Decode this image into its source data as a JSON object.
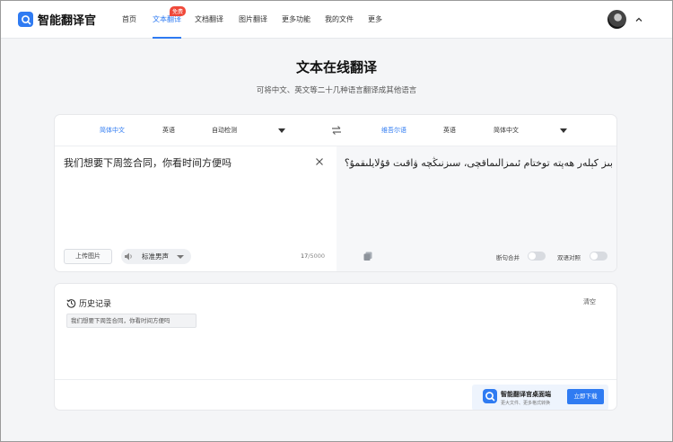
{
  "app": {
    "name": "智能翻译官"
  },
  "nav": {
    "items": [
      {
        "label": "首页"
      },
      {
        "label": "文本翻译",
        "badge": "免费"
      },
      {
        "label": "文档翻译"
      },
      {
        "label": "图片翻译"
      },
      {
        "label": "更多功能"
      },
      {
        "label": "我的文件"
      },
      {
        "label": "更多"
      }
    ]
  },
  "hero": {
    "title": "文本在线翻译",
    "subtitle": "可将中文、英文等二十几种语言翻译成其他语言"
  },
  "source_langs": {
    "items": [
      "简体中文",
      "英语",
      "自动检测"
    ]
  },
  "target_langs": {
    "items": [
      "维吾尔语",
      "英语",
      "简体中文"
    ]
  },
  "source": {
    "text": "我们想要下周签合同，你看时间方便吗",
    "count": "17",
    "max": "/5000"
  },
  "output": {
    "text": "بىز كېلەر ھەپتە توختام ئىمزالىماقچى، سىزنىڭچە ۋاقىت قۇلايلىقمۇ؟"
  },
  "controls": {
    "upload_label": "上传图片",
    "voice_label": "标准男声",
    "merge_label": "断句合并",
    "bilingual_label": "双语对照"
  },
  "history": {
    "title": "历史记录",
    "clear_label": "清空",
    "items": [
      "我们想要下周签合同，你看时间方便吗"
    ]
  },
  "promo": {
    "title": "智能翻译官桌面端",
    "subtitle": "更大文件、更多格式转换",
    "button": "立即下载"
  },
  "colors": {
    "accent": "#2f7bf2",
    "badge": "#f0493a"
  },
  "icons": [
    "logo-icon",
    "chevron-up-icon",
    "swap-icon",
    "close-icon",
    "speaker-icon",
    "copy-icon",
    "history-icon"
  ]
}
